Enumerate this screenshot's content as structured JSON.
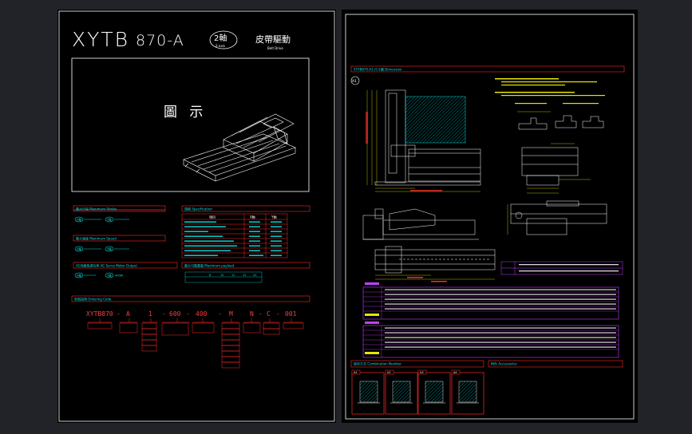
{
  "sheet1": {
    "model_prefix": "XYTB",
    "model_number": "870-A",
    "axis_badge": "2軸",
    "axis_badge_en": "2-axis",
    "drive_type": "皮帶驅動",
    "drive_type_en": "Belt Drive",
    "figure_label": "圖 示",
    "max_stroke_header": "最大行程 Maximum Stroke",
    "max_speed_header": "最大速度 Maximum Speed",
    "ac_servo_header": "AC伺服馬達功率 AC Servo Motor Output",
    "spec_header": "規格 Specification",
    "payload_header": "最大可搬重量 Maximum payload",
    "order_header": "型號說明 Ordering Code",
    "order_code": [
      "XYTB870",
      "-",
      "A",
      "1",
      "-",
      "600",
      "-",
      "400",
      "-",
      "M",
      "N",
      "-",
      "C",
      "-",
      "001"
    ],
    "stroke_x": "X軸",
    "stroke_y": "Y軸",
    "speed_x": "X軸",
    "speed_y": "Y軸",
    "motor_x": "X軸",
    "motor_y": "Y軸",
    "motor_value": "400W",
    "payload_values": [
      "8",
      "10",
      "12",
      "15",
      "20"
    ],
    "spec_cols": [
      "項目",
      "X軸",
      "Y軸"
    ]
  },
  "sheet2": {
    "section_dimension": "XYTB870-A1 尺寸圖 Dimension",
    "view_label": "A1",
    "section_combination": "組合方式 Combination Number",
    "section_accessories": "附件 Accessories",
    "combo_labels": [
      "A1",
      "A2",
      "A3",
      "A4"
    ]
  },
  "colors": {
    "background": "#222329",
    "paper": "#000000",
    "line": "#ffffff",
    "red": "#ff2a2a",
    "cyan": "#00e0e0",
    "yellow": "#e6e600",
    "green": "#00d400",
    "magenta": "#c040ff"
  }
}
